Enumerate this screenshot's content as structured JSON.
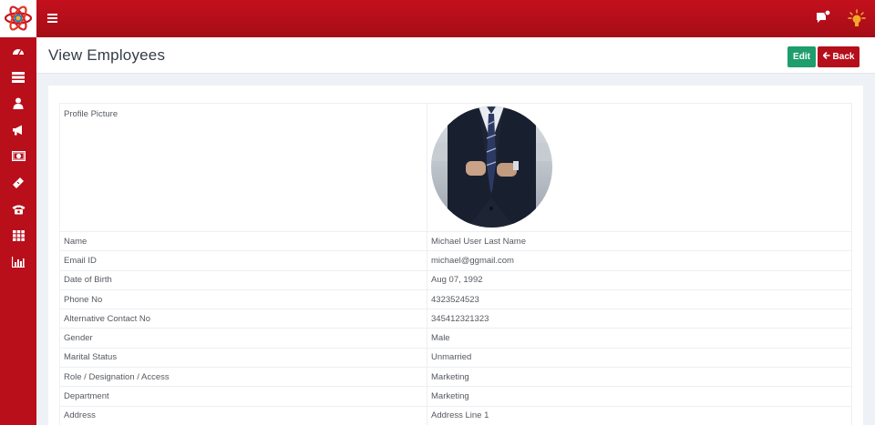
{
  "header": {
    "page_title": "View Employees",
    "edit_label": "Edit",
    "back_label": "Back"
  },
  "topbar": {
    "logo_icon": "atom-logo-icon",
    "menu_icon": "hamburger-icon",
    "chat_icon": "chat-notification-icon",
    "bulb_icon": "lightbulb-icon"
  },
  "sidebar": {
    "items": [
      {
        "icon": "dashboard-icon"
      },
      {
        "icon": "list-icon"
      },
      {
        "icon": "user-icon"
      },
      {
        "icon": "megaphone-icon"
      },
      {
        "icon": "money-icon"
      },
      {
        "icon": "ticket-icon"
      },
      {
        "icon": "phone-icon"
      },
      {
        "icon": "grid-icon"
      },
      {
        "icon": "bar-chart-icon"
      }
    ]
  },
  "details": {
    "profile_picture_label": "Profile Picture",
    "rows": [
      {
        "label": "Name",
        "value": "Michael User Last Name"
      },
      {
        "label": "Email ID",
        "value": "michael@ggmail.com"
      },
      {
        "label": "Date of Birth",
        "value": "Aug 07, 1992"
      },
      {
        "label": "Phone No",
        "value": "4323524523"
      },
      {
        "label": "Alternative Contact No",
        "value": "345412321323"
      },
      {
        "label": "Gender",
        "value": "Male"
      },
      {
        "label": "Marital Status",
        "value": "Unmarried"
      },
      {
        "label": "Role / Designation / Access",
        "value": "Marketing"
      },
      {
        "label": "Department",
        "value": "Marketing"
      },
      {
        "label": "Address",
        "value": "Address Line 1"
      }
    ]
  },
  "colors": {
    "brand_red": "#b80f1b",
    "edit_green": "#1e9d6d"
  }
}
